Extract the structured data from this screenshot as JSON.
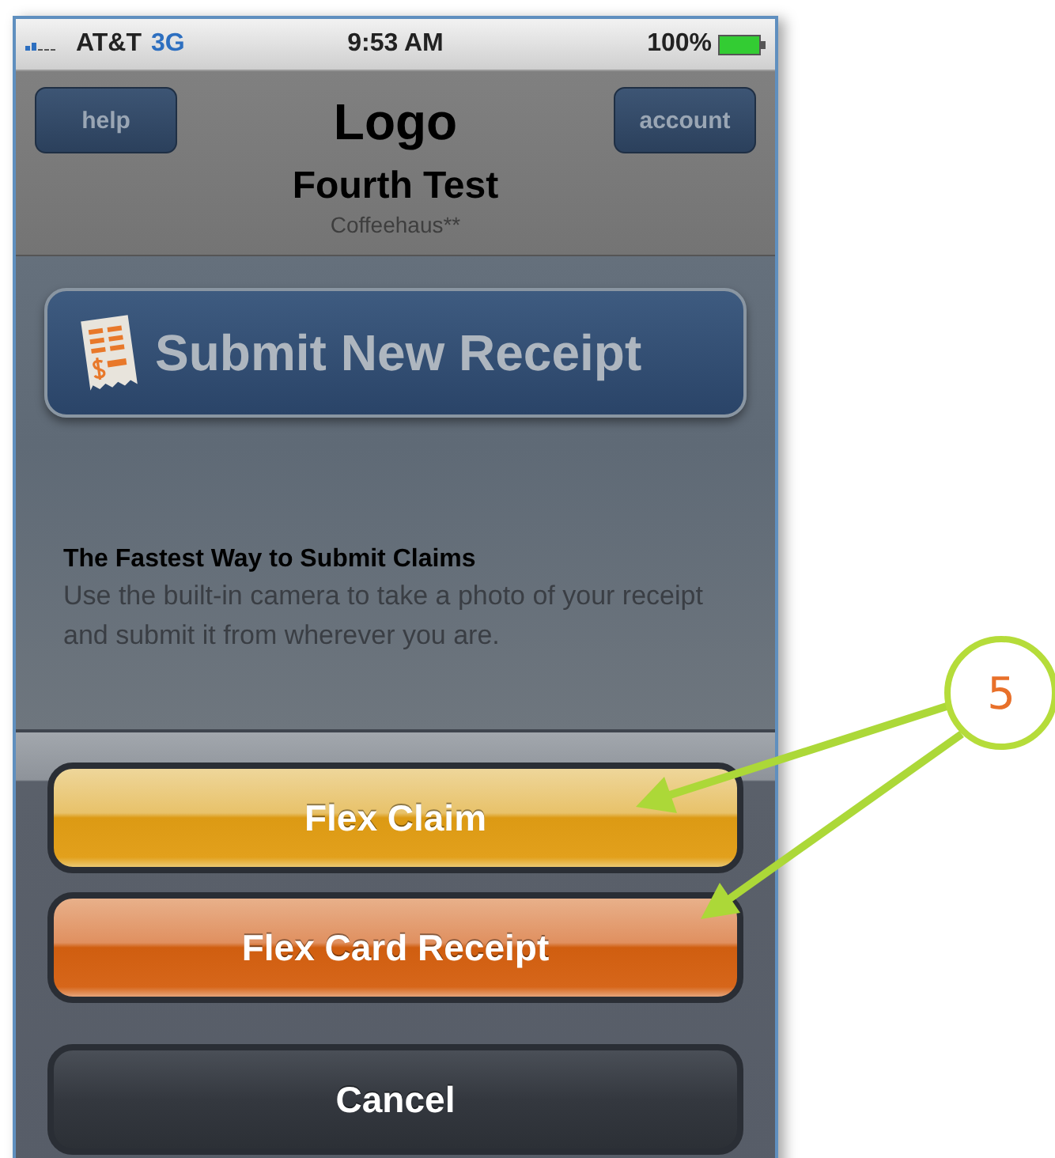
{
  "status_bar": {
    "carrier": "AT&T",
    "network": "3G",
    "time": "9:53 AM",
    "battery": "100%"
  },
  "header": {
    "left_button": "help",
    "logo": "Logo",
    "title": "Fourth Test",
    "subtitle": "Coffeehaus**",
    "right_button": "account"
  },
  "submit_button": {
    "label": "Submit New Receipt"
  },
  "info": {
    "heading": "The Fastest Way to Submit Claims",
    "body": "Use the built-in camera to take a photo of your receipt and submit it from wherever you are."
  },
  "action_sheet": {
    "buttons": [
      {
        "label": "Flex Claim",
        "kind": "primary"
      },
      {
        "label": "Flex Card Receipt",
        "kind": "secondary"
      },
      {
        "label": "Cancel",
        "kind": "cancel"
      }
    ]
  },
  "callout": {
    "number": "5"
  }
}
